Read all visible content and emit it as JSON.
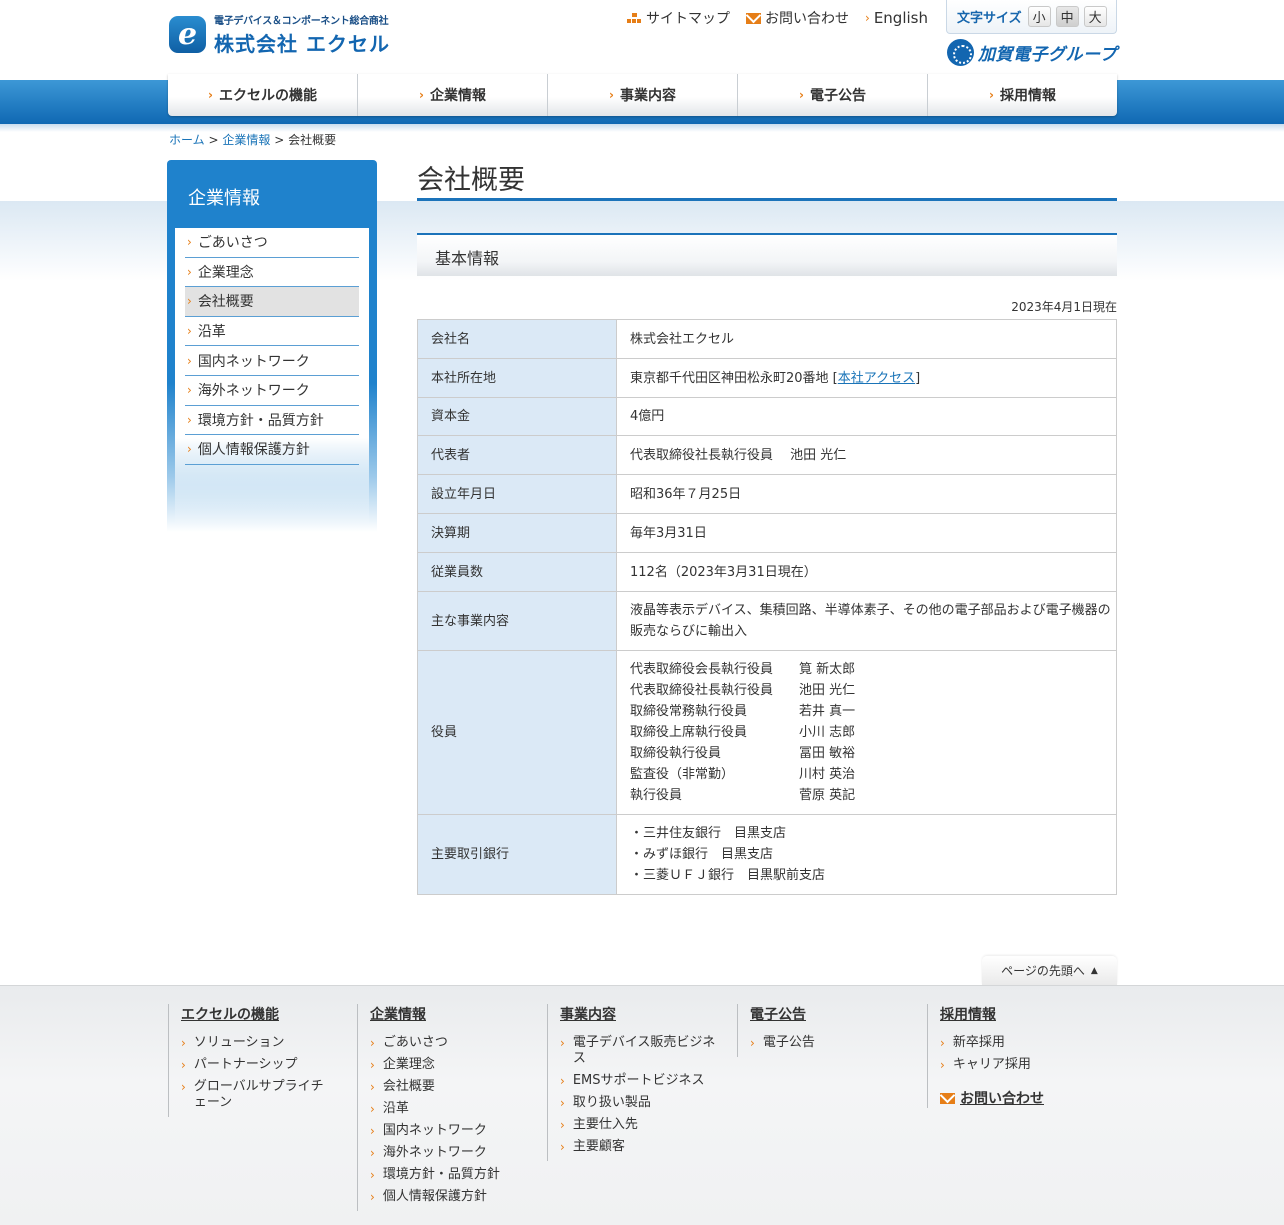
{
  "header": {
    "logo_tagline": "電子デバイス＆コンポーネント総合商社",
    "logo_name": "株式会社 エクセル",
    "logo_mark": "e",
    "util_links": [
      "サイトマップ",
      "お問い合わせ",
      "English"
    ],
    "fontsize_label": "文字サイズ",
    "fontsize_options": [
      "小",
      "中",
      "大"
    ],
    "group_name": "加賀電子グループ"
  },
  "nav": [
    "エクセルの機能",
    "企業情報",
    "事業内容",
    "電子公告",
    "採用情報"
  ],
  "breadcrumb": {
    "home": "ホーム",
    "parent": "企業情報",
    "current": "会社概要",
    "sep": ">"
  },
  "sidebar": {
    "title": "企業情報",
    "items": [
      "ごあいさつ",
      "企業理念",
      "会社概要",
      "沿革",
      "国内ネットワーク",
      "海外ネットワーク",
      "環境方針・品質方針",
      "個人情報保護方針"
    ]
  },
  "main": {
    "title": "会社概要",
    "section": "基本情報",
    "as_of": "2023年4月1日現在",
    "rows": {
      "company_label": "会社名",
      "company": "株式会社エクセル",
      "address_label": "本社所在地",
      "address": "東京都千代田区神田松永町20番地",
      "access_link": "本社アクセス",
      "capital_label": "資本金",
      "capital": "4億円",
      "rep_label": "代表者",
      "rep": "代表取締役社長執行役員　 池田 光仁",
      "founded_label": "設立年月日",
      "founded": "昭和36年７月25日",
      "fiscal_label": "決算期",
      "fiscal": "毎年3月31日",
      "employees_label": "従業員数",
      "employees": "112名（2023年3月31日現在）",
      "business_label": "主な事業内容",
      "business": "液晶等表示デバイス、集積回路、半導体素子、その他の電子部品および電子機器の販売ならびに輸出入",
      "officers_label": "役員",
      "officers": [
        {
          "title": "代表取締役会長執行役員",
          "name": "筧 新太郎"
        },
        {
          "title": "代表取締役社長執行役員",
          "name": "池田 光仁"
        },
        {
          "title": "取締役常務執行役員",
          "name": "若井 真一"
        },
        {
          "title": "取締役上席執行役員",
          "name": "小川 志郎"
        },
        {
          "title": "取締役執行役員",
          "name": "冨田 敏裕"
        },
        {
          "title": "監査役（非常勤）",
          "name": "川村 英治"
        },
        {
          "title": "執行役員",
          "name": "菅原 英記"
        }
      ],
      "banks_label": "主要取引銀行",
      "banks": [
        "・三井住友銀行　目黒支店",
        "・みずほ銀行　目黒支店",
        "・三菱ＵＦＪ銀行　目黒駅前支店"
      ]
    }
  },
  "pagetop": "ページの先頭へ",
  "footer": {
    "col1": {
      "head": "エクセルの機能",
      "links": [
        "ソリューション",
        "パートナーシップ",
        "グローバルサプライチェーン"
      ]
    },
    "col2": {
      "head": "企業情報",
      "links": [
        "ごあいさつ",
        "企業理念",
        "会社概要",
        "沿革",
        "国内ネットワーク",
        "海外ネットワーク",
        "環境方針・品質方針",
        "個人情報保護方針"
      ]
    },
    "col3": {
      "head": "事業内容",
      "links": [
        "電子デバイス販売ビジネス",
        "EMSサポートビジネス",
        "取り扱い製品",
        "主要仕入先",
        "主要顧客"
      ]
    },
    "col4": {
      "head": "電子公告",
      "links": [
        "電子公告"
      ]
    },
    "col5": {
      "head": "採用情報",
      "links": [
        "新卒採用",
        "キャリア採用"
      ],
      "contact": "お問い合わせ"
    }
  }
}
